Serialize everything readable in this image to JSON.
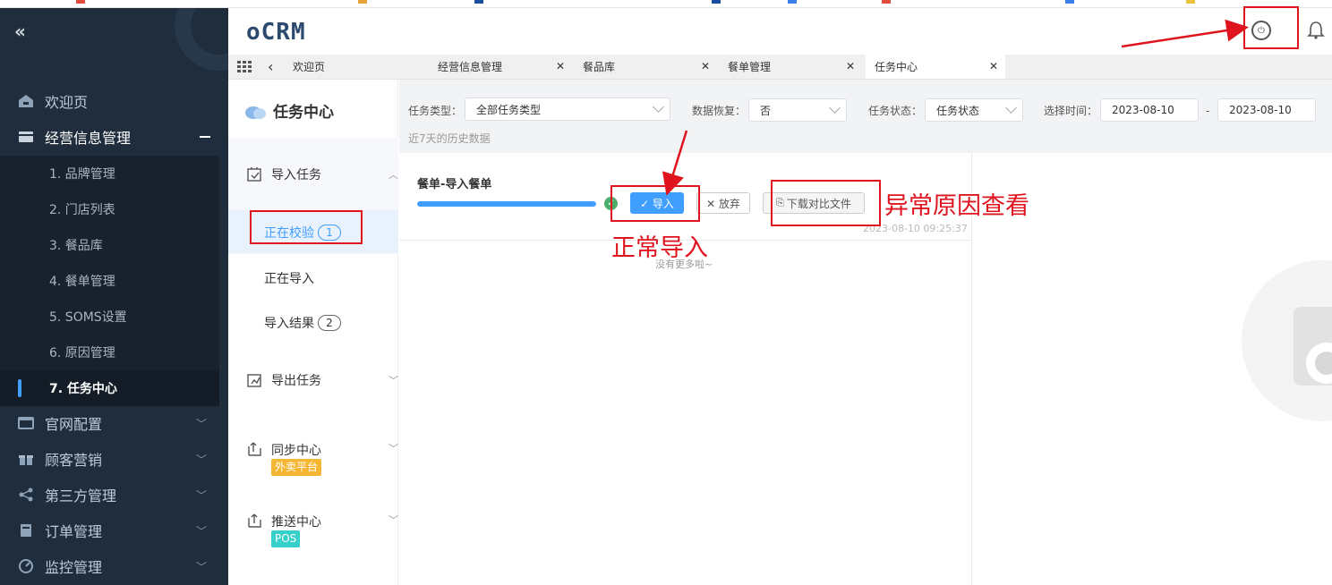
{
  "app": {
    "logo": "oCRM"
  },
  "sidebar": {
    "collapse_icon": "«",
    "items": [
      {
        "label": "欢迎页",
        "icon": "home-icon"
      },
      {
        "label": "经营信息管理",
        "icon": "business-icon",
        "expanded": true
      },
      {
        "label": "官网配置",
        "icon": "website-icon"
      },
      {
        "label": "顾客营销",
        "icon": "gift-icon"
      },
      {
        "label": "第三方管理",
        "icon": "share-icon"
      },
      {
        "label": "订单管理",
        "icon": "order-icon"
      },
      {
        "label": "监控管理",
        "icon": "monitor-icon"
      }
    ],
    "submenu": [
      "1. 品牌管理",
      "2. 门店列表",
      "3. 餐品库",
      "4. 餐单管理",
      "5. SOMS设置",
      "6. 原因管理",
      "7. 任务中心"
    ],
    "active_sub": "7. 任务中心"
  },
  "tabs": [
    {
      "label": "欢迎页"
    },
    {
      "label": "经营信息管理",
      "close": "✕"
    },
    {
      "label": "餐品库",
      "close": "✕"
    },
    {
      "label": "餐单管理",
      "close": "✕"
    },
    {
      "label": "任务中心",
      "close": "✕",
      "active": true
    }
  ],
  "task_panel": {
    "title": "任务中心",
    "groups": [
      {
        "label": "导入任务",
        "icon": "import-icon"
      },
      {
        "label": "导出任务",
        "icon": "export-icon"
      },
      {
        "label": "同步中心",
        "icon": "sync-icon",
        "tag": "外卖平台",
        "tag_color": "#f5b634"
      },
      {
        "label": "推送中心",
        "icon": "push-icon",
        "tag": "POS",
        "tag_color": "#36cfc9"
      }
    ],
    "import_sub": [
      {
        "label": "正在校验",
        "count": "1"
      },
      {
        "label": "正在导入"
      },
      {
        "label": "导入结果",
        "count": "2"
      }
    ]
  },
  "filters": {
    "task_type_label": "任务类型：",
    "task_type_value": "全部任务类型",
    "data_restore_label": "数据恢复：",
    "data_restore_value": "否",
    "task_status_label": "任务状态：",
    "task_status_value": "任务状态",
    "time_label": "选择时间：",
    "date_from": "2023-08-10",
    "date_sep": "-",
    "date_to": "2023-08-10",
    "hint": "近7天的历史数据"
  },
  "task": {
    "name": "餐单-导入餐单",
    "progress": 1.0,
    "import_label": "✓ 导入",
    "discard_label": "✕ 放弃",
    "download_label": "下载对比文件",
    "time": "2023-08-10 09:25:37",
    "no_more": "没有更多啦~"
  },
  "annotations": {
    "normal_import": "正常导入",
    "abnormal_reason": "异常原因查看"
  },
  "colors": {
    "sidebar": "#1f2d3d",
    "primary": "#409eff",
    "annotation": "#e0141e",
    "success": "#4cae6a"
  }
}
